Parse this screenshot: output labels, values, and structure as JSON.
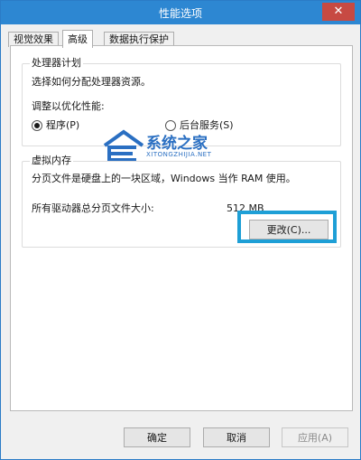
{
  "window": {
    "title": "性能选项",
    "close_label": "✕"
  },
  "tabs": [
    {
      "label": "视觉效果",
      "active": false
    },
    {
      "label": "高级",
      "active": true
    },
    {
      "label": "数据执行保护",
      "active": false
    }
  ],
  "processor": {
    "group_title": "处理器计划",
    "description": "选择如何分配处理器资源。",
    "optimize_label": "调整以优化性能:",
    "options": [
      {
        "label": "程序(P)",
        "selected": true
      },
      {
        "label": "后台服务(S)",
        "selected": false
      }
    ]
  },
  "virtual_memory": {
    "group_title": "虚拟内存",
    "description": "分页文件是硬盘上的一块区域，Windows 当作 RAM 使用。",
    "total_label": "所有驱动器总分页文件大小:",
    "total_value": "512 MB",
    "change_button": "更改(C)..."
  },
  "watermark": {
    "text": "系统之家",
    "sub": "XITONGZHIJIA.NET"
  },
  "footer": {
    "ok": "确定",
    "cancel": "取消",
    "apply": "应用(A)"
  },
  "colors": {
    "titlebar": "#2d87d2",
    "highlight": "#1e9fd6",
    "watermark": "#2a6fc2"
  }
}
